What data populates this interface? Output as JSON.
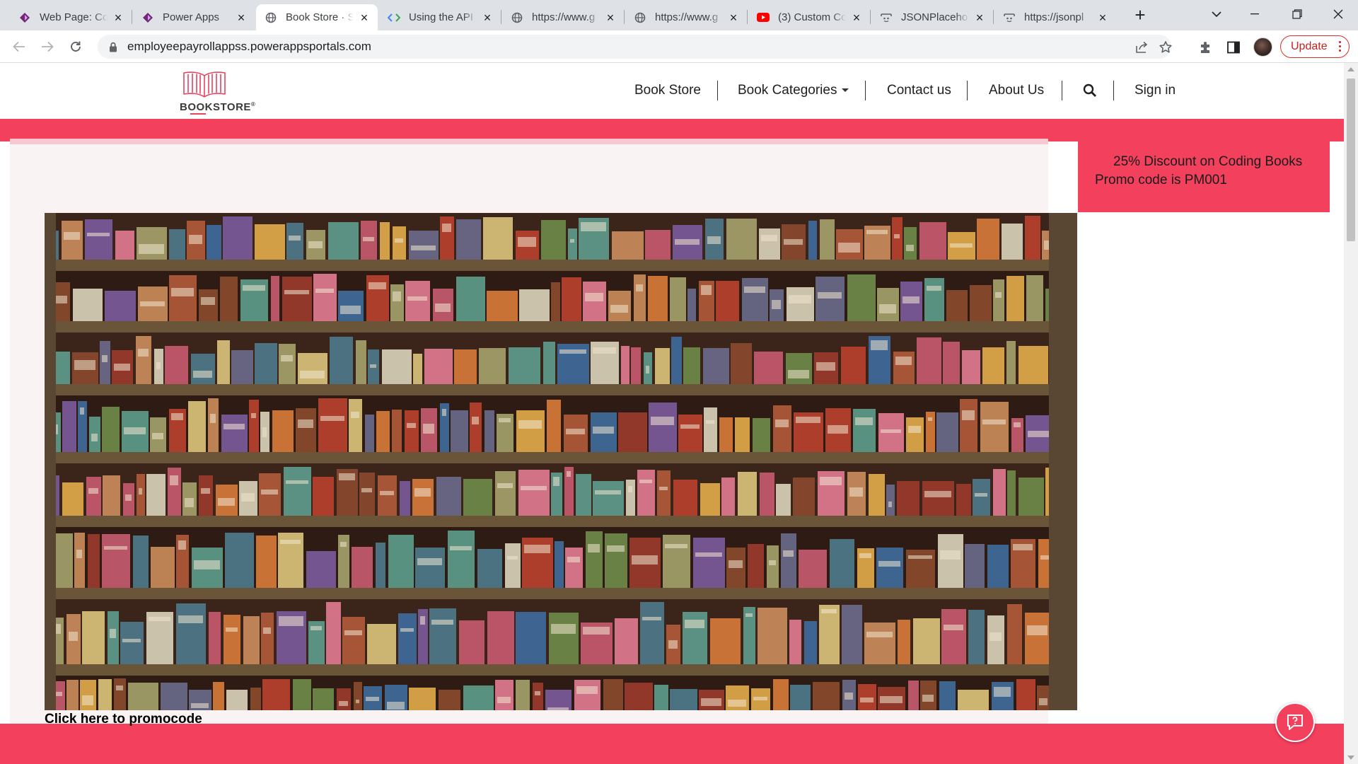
{
  "browser": {
    "tabs": [
      {
        "title": "Web Page: Co",
        "favicon": "powerapps-icon",
        "active": false
      },
      {
        "title": "Power Apps",
        "favicon": "powerapps-icon",
        "active": false
      },
      {
        "title": "Book Store · S",
        "favicon": "globe-icon",
        "active": true
      },
      {
        "title": "Using the API",
        "favicon": "code-icon",
        "active": false
      },
      {
        "title": "https://www.g",
        "favicon": "globe-icon",
        "active": false
      },
      {
        "title": "https://www.g",
        "favicon": "globe-icon",
        "active": false
      },
      {
        "title": "(3) Custom Co",
        "favicon": "youtube-icon",
        "active": false
      },
      {
        "title": "JSONPlacehol",
        "favicon": "jsonplaceholder-icon",
        "active": false
      },
      {
        "title": "https://jsonpl",
        "favicon": "jsonplaceholder-icon",
        "active": false
      }
    ],
    "url": "employeepayrollappss.powerappsportals.com",
    "update_label": "Update"
  },
  "site": {
    "logo_text": "BOOKSTORE",
    "nav": {
      "book_store": "Book Store",
      "book_categories": "Book Categories",
      "contact_us": "Contact us",
      "about_us": "About Us",
      "sign_in": "Sign in"
    },
    "promo": {
      "line1": "25% Discount on Coding Books",
      "line2": "Promo code is  PM001"
    },
    "promo_link": "Click here to promocode"
  },
  "colors": {
    "brand_pink": "#f2405d",
    "content_bg": "#faf3f3"
  }
}
